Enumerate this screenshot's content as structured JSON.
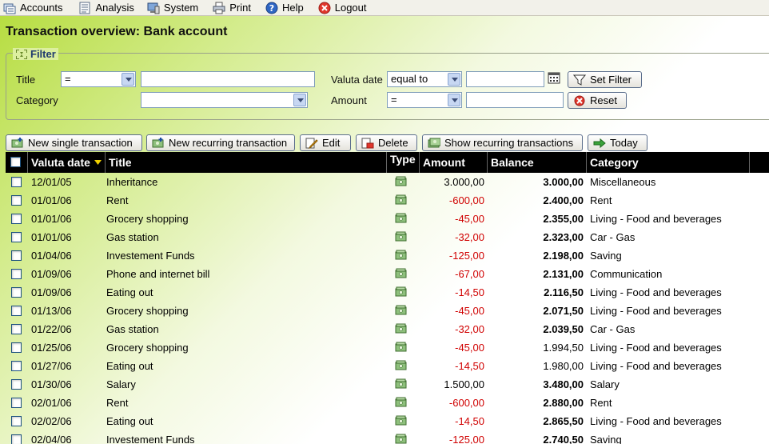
{
  "menu": [
    {
      "label": "Accounts",
      "icon": "accounts-icon"
    },
    {
      "label": "Analysis",
      "icon": "analysis-icon"
    },
    {
      "label": "System",
      "icon": "system-icon"
    },
    {
      "label": "Print",
      "icon": "print-icon"
    },
    {
      "label": "Help",
      "icon": "help-icon"
    },
    {
      "label": "Logout",
      "icon": "logout-icon"
    }
  ],
  "page_title": "Transaction overview: Bank account",
  "filter": {
    "legend": "Filter",
    "title_label": "Title",
    "title_operator": "=",
    "title_value": "",
    "category_label": "Category",
    "category_value": "",
    "valuta_label": "Valuta date",
    "valuta_operator": "equal to",
    "valuta_value": "",
    "amount_label": "Amount",
    "amount_operator": "=",
    "amount_value": "",
    "set_filter_label": "Set Filter",
    "reset_label": "Reset"
  },
  "toolbar": {
    "new_single": "New single transaction",
    "new_recurring": "New recurring transaction",
    "edit": "Edit",
    "delete": "Delete",
    "show_recurring": "Show recurring transactions",
    "today": "Today"
  },
  "table": {
    "columns": {
      "date": "Valuta date",
      "title": "Title",
      "type": "Type",
      "amount": "Amount",
      "balance": "Balance",
      "category": "Category"
    },
    "sorted_column": "date",
    "rows": [
      {
        "date": "12/01/05",
        "title": "Inheritance",
        "amount": "3.000,00",
        "negative": false,
        "balance": "3.000,00",
        "balance_bold": true,
        "category": "Miscellaneous"
      },
      {
        "date": "01/01/06",
        "title": "Rent",
        "amount": "-600,00",
        "negative": true,
        "balance": "2.400,00",
        "balance_bold": true,
        "category": "Rent"
      },
      {
        "date": "01/01/06",
        "title": "Grocery shopping",
        "amount": "-45,00",
        "negative": true,
        "balance": "2.355,00",
        "balance_bold": true,
        "category": "Living - Food and beverages"
      },
      {
        "date": "01/01/06",
        "title": "Gas station",
        "amount": "-32,00",
        "negative": true,
        "balance": "2.323,00",
        "balance_bold": true,
        "category": "Car - Gas"
      },
      {
        "date": "01/04/06",
        "title": "Investement Funds",
        "amount": "-125,00",
        "negative": true,
        "balance": "2.198,00",
        "balance_bold": true,
        "category": "Saving"
      },
      {
        "date": "01/09/06",
        "title": "Phone and internet bill",
        "amount": "-67,00",
        "negative": true,
        "balance": "2.131,00",
        "balance_bold": true,
        "category": "Communication"
      },
      {
        "date": "01/09/06",
        "title": "Eating out",
        "amount": "-14,50",
        "negative": true,
        "balance": "2.116,50",
        "balance_bold": true,
        "category": "Living - Food and beverages"
      },
      {
        "date": "01/13/06",
        "title": "Grocery shopping",
        "amount": "-45,00",
        "negative": true,
        "balance": "2.071,50",
        "balance_bold": true,
        "category": "Living - Food and beverages"
      },
      {
        "date": "01/22/06",
        "title": "Gas station",
        "amount": "-32,00",
        "negative": true,
        "balance": "2.039,50",
        "balance_bold": true,
        "category": "Car - Gas"
      },
      {
        "date": "01/25/06",
        "title": "Grocery shopping",
        "amount": "-45,00",
        "negative": true,
        "balance": "1.994,50",
        "balance_bold": false,
        "category": "Living - Food and beverages"
      },
      {
        "date": "01/27/06",
        "title": "Eating out",
        "amount": "-14,50",
        "negative": true,
        "balance": "1.980,00",
        "balance_bold": false,
        "category": "Living - Food and beverages"
      },
      {
        "date": "01/30/06",
        "title": "Salary",
        "amount": "1.500,00",
        "negative": false,
        "balance": "3.480,00",
        "balance_bold": true,
        "category": "Salary"
      },
      {
        "date": "02/01/06",
        "title": "Rent",
        "amount": "-600,00",
        "negative": true,
        "balance": "2.880,00",
        "balance_bold": true,
        "category": "Rent"
      },
      {
        "date": "02/02/06",
        "title": "Eating out",
        "amount": "-14,50",
        "negative": true,
        "balance": "2.865,50",
        "balance_bold": true,
        "category": "Living - Food and beverages"
      },
      {
        "date": "02/04/06",
        "title": "Investement Funds",
        "amount": "-125,00",
        "negative": true,
        "balance": "2.740,50",
        "balance_bold": true,
        "category": "Saving"
      }
    ]
  },
  "colors": {
    "negative_amount": "#d00000",
    "header_bg": "#000000",
    "header_text": "#ffffff",
    "gradient_green": "#b5dc3c"
  }
}
